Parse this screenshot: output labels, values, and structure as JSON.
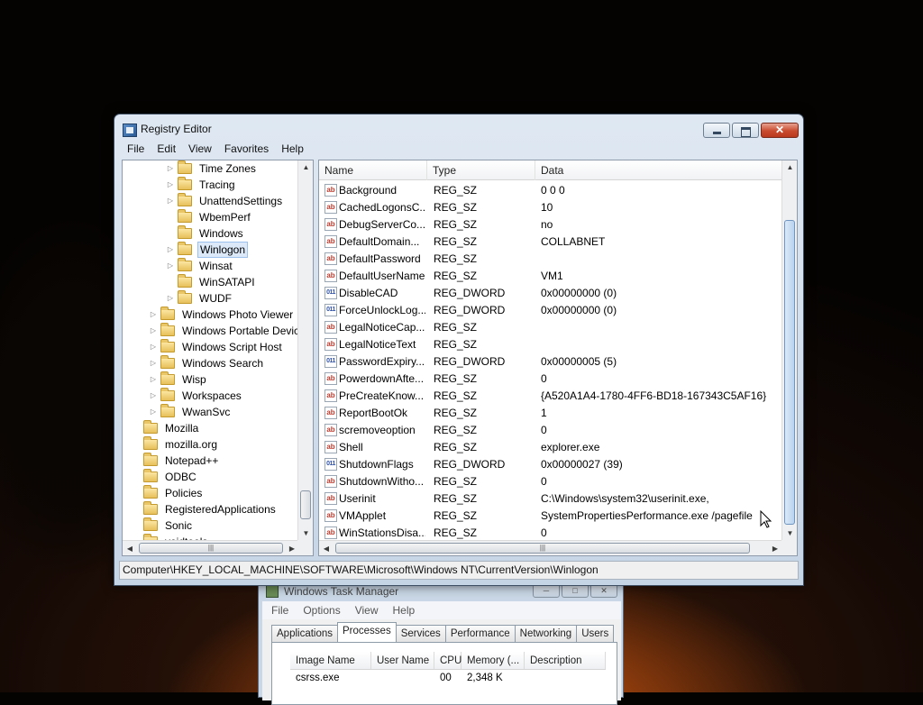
{
  "registry_editor": {
    "title": "Registry Editor",
    "menu": [
      "File",
      "Edit",
      "View",
      "Favorites",
      "Help"
    ],
    "tree": [
      {
        "label": "Time Zones",
        "level": 2,
        "expandable": true
      },
      {
        "label": "Tracing",
        "level": 2,
        "expandable": true
      },
      {
        "label": "UnattendSettings",
        "level": 2,
        "expandable": true
      },
      {
        "label": "WbemPerf",
        "level": 2,
        "expandable": false
      },
      {
        "label": "Windows",
        "level": 2,
        "expandable": false
      },
      {
        "label": "Winlogon",
        "level": 2,
        "expandable": true,
        "selected": true
      },
      {
        "label": "Winsat",
        "level": 2,
        "expandable": true
      },
      {
        "label": "WinSATAPI",
        "level": 2,
        "expandable": false
      },
      {
        "label": "WUDF",
        "level": 2,
        "expandable": true
      },
      {
        "label": "Windows Photo Viewer",
        "level": 1,
        "expandable": true
      },
      {
        "label": "Windows Portable Devices",
        "level": 1,
        "expandable": true
      },
      {
        "label": "Windows Script Host",
        "level": 1,
        "expandable": true
      },
      {
        "label": "Windows Search",
        "level": 1,
        "expandable": true
      },
      {
        "label": "Wisp",
        "level": 1,
        "expandable": true
      },
      {
        "label": "Workspaces",
        "level": 1,
        "expandable": true
      },
      {
        "label": "WwanSvc",
        "level": 1,
        "expandable": true
      },
      {
        "label": "Mozilla",
        "level": 0,
        "expandable": false
      },
      {
        "label": "mozilla.org",
        "level": 0,
        "expandable": false
      },
      {
        "label": "Notepad++",
        "level": 0,
        "expandable": false
      },
      {
        "label": "ODBC",
        "level": 0,
        "expandable": false
      },
      {
        "label": "Policies",
        "level": 0,
        "expandable": false
      },
      {
        "label": "RegisteredApplications",
        "level": 0,
        "expandable": false
      },
      {
        "label": "Sonic",
        "level": 0,
        "expandable": false
      },
      {
        "label": "voidtools",
        "level": 0,
        "expandable": false
      }
    ],
    "columns": {
      "name": "Name",
      "type": "Type",
      "data": "Data"
    },
    "values": [
      {
        "icon": "string-value-icon",
        "name": "Background",
        "type": "REG_SZ",
        "data": "0 0 0"
      },
      {
        "icon": "string-value-icon",
        "name": "CachedLogonsC...",
        "type": "REG_SZ",
        "data": "10"
      },
      {
        "icon": "string-value-icon",
        "name": "DebugServerCo...",
        "type": "REG_SZ",
        "data": "no"
      },
      {
        "icon": "string-value-icon",
        "name": "DefaultDomain...",
        "type": "REG_SZ",
        "data": "COLLABNET"
      },
      {
        "icon": "string-value-icon",
        "name": "DefaultPassword",
        "type": "REG_SZ",
        "data": ""
      },
      {
        "icon": "string-value-icon",
        "name": "DefaultUserName",
        "type": "REG_SZ",
        "data": "VM1"
      },
      {
        "icon": "dword-value-icon",
        "name": "DisableCAD",
        "type": "REG_DWORD",
        "data": "0x00000000 (0)"
      },
      {
        "icon": "dword-value-icon",
        "name": "ForceUnlockLog...",
        "type": "REG_DWORD",
        "data": "0x00000000 (0)"
      },
      {
        "icon": "string-value-icon",
        "name": "LegalNoticeCap...",
        "type": "REG_SZ",
        "data": ""
      },
      {
        "icon": "string-value-icon",
        "name": "LegalNoticeText",
        "type": "REG_SZ",
        "data": ""
      },
      {
        "icon": "dword-value-icon",
        "name": "PasswordExpiry...",
        "type": "REG_DWORD",
        "data": "0x00000005 (5)"
      },
      {
        "icon": "string-value-icon",
        "name": "PowerdownAfte...",
        "type": "REG_SZ",
        "data": "0"
      },
      {
        "icon": "string-value-icon",
        "name": "PreCreateKnow...",
        "type": "REG_SZ",
        "data": "{A520A1A4-1780-4FF6-BD18-167343C5AF16}"
      },
      {
        "icon": "string-value-icon",
        "name": "ReportBootOk",
        "type": "REG_SZ",
        "data": "1"
      },
      {
        "icon": "string-value-icon",
        "name": "scremoveoption",
        "type": "REG_SZ",
        "data": "0"
      },
      {
        "icon": "string-value-icon",
        "name": "Shell",
        "type": "REG_SZ",
        "data": "explorer.exe"
      },
      {
        "icon": "dword-value-icon",
        "name": "ShutdownFlags",
        "type": "REG_DWORD",
        "data": "0x00000027 (39)"
      },
      {
        "icon": "string-value-icon",
        "name": "ShutdownWitho...",
        "type": "REG_SZ",
        "data": "0"
      },
      {
        "icon": "string-value-icon",
        "name": "Userinit",
        "type": "REG_SZ",
        "data": "C:\\Windows\\system32\\userinit.exe,"
      },
      {
        "icon": "string-value-icon",
        "name": "VMApplet",
        "type": "REG_SZ",
        "data": "SystemPropertiesPerformance.exe /pagefile"
      },
      {
        "icon": "string-value-icon",
        "name": "WinStationsDisa...",
        "type": "REG_SZ",
        "data": "0"
      }
    ],
    "status_path": "Computer\\HKEY_LOCAL_MACHINE\\SOFTWARE\\Microsoft\\Windows NT\\CurrentVersion\\Winlogon"
  },
  "task_manager": {
    "title": "Windows Task Manager",
    "menu": [
      "File",
      "Options",
      "View",
      "Help"
    ],
    "tabs": [
      {
        "label": "Applications",
        "active": false
      },
      {
        "label": "Processes",
        "active": true
      },
      {
        "label": "Services",
        "active": false
      },
      {
        "label": "Performance",
        "active": false
      },
      {
        "label": "Networking",
        "active": false
      },
      {
        "label": "Users",
        "active": false
      }
    ],
    "columns": [
      "Image Name",
      "User Name",
      "CPU",
      "Memory (...",
      "Description"
    ],
    "rows": [
      {
        "image": "csrss.exe",
        "user": "",
        "cpu": "00",
        "memory": "2,348 K",
        "description": ""
      }
    ]
  },
  "colors": {
    "selection_bg": "#dbe9f9",
    "close_button": "#c94a2e",
    "string_icon": "#c0392b",
    "dword_icon": "#2d4fa3"
  }
}
